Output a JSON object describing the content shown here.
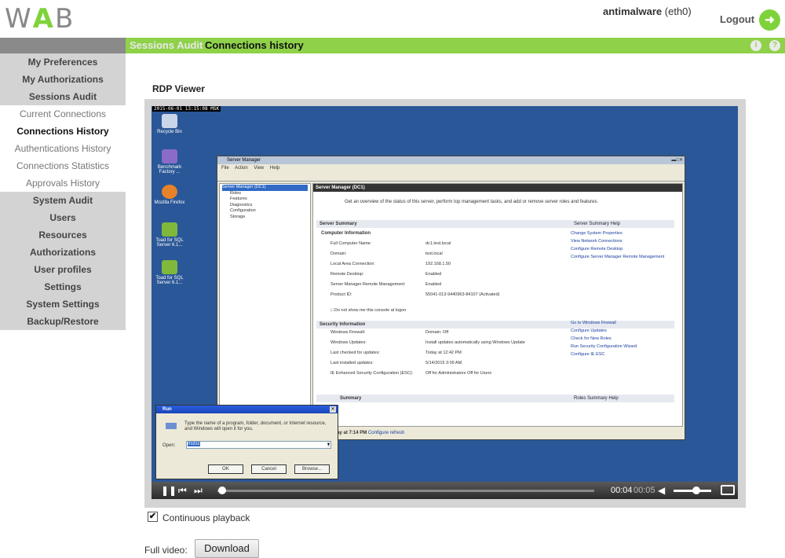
{
  "header": {
    "logo_left": "W",
    "logo_mid": "A",
    "logo_right": "B",
    "user_name": "antimalware",
    "user_iface": "(eth0)",
    "logout_label": "Logout"
  },
  "navbar": {
    "parent": "Sessions Audit",
    "current": "Connections history",
    "info_icon": "i",
    "help_icon": "?"
  },
  "sidebar": {
    "items": [
      {
        "label": "My Preferences",
        "type": "section"
      },
      {
        "label": "My Authorizations",
        "type": "section"
      },
      {
        "label": "Sessions Audit",
        "type": "section"
      },
      {
        "label": "Current Connections",
        "type": "sub"
      },
      {
        "label": "Connections History",
        "type": "sub-active"
      },
      {
        "label": "Authentications History",
        "type": "sub"
      },
      {
        "label": "Connections Statistics",
        "type": "sub"
      },
      {
        "label": "Approvals History",
        "type": "sub"
      },
      {
        "label": "System Audit",
        "type": "section"
      },
      {
        "label": "Users",
        "type": "section"
      },
      {
        "label": "Resources",
        "type": "section"
      },
      {
        "label": "Authorizations",
        "type": "section"
      },
      {
        "label": "User profiles",
        "type": "section"
      },
      {
        "label": "Settings",
        "type": "section"
      },
      {
        "label": "System Settings",
        "type": "section"
      },
      {
        "label": "Backup/Restore",
        "type": "section"
      }
    ]
  },
  "main": {
    "title": "RDP Viewer",
    "continuous_label": "Continuous playback",
    "continuous_checked": true,
    "full_video_label": "Full video:",
    "download_label": "Download"
  },
  "player": {
    "timestamp": "2015-06-01 13:15:08 MSK",
    "current_time": "00:04",
    "total_time": "00:05",
    "progress_fraction": 0.01,
    "volume_fraction": 0.6
  },
  "desktop": {
    "icons": [
      "Recycle Bin",
      "Benchmark Factory ...",
      "Mozilla Firefox",
      "Toad for SQL Server 6.1...",
      "Toad for SQL Server 6.1..."
    ]
  },
  "server_manager": {
    "title": "Server Manager",
    "menu": "File  Action  View  Help",
    "tree": [
      "Server Manager (DC1)",
      "Roles",
      "Features",
      "Diagnostics",
      "Configuration",
      "Storage"
    ],
    "header": "Server Manager (DC1)",
    "desc": "Get an overview of the status of this server, perform top management tasks, and add or remove server roles and features.",
    "summary_title": "Server Summary",
    "summary_help": "Server Summary Help",
    "computer_info": "Computer Information",
    "kv": [
      {
        "k": "Full Computer Name:",
        "v": "dc1.test.local"
      },
      {
        "k": "Domain:",
        "v": "test.local"
      },
      {
        "k": "Local Area Connection:",
        "v": "192.168.1.50"
      },
      {
        "k": "Remote Desktop:",
        "v": "Enabled"
      },
      {
        "k": "Server Manager Remote Management:",
        "v": "Enabled"
      },
      {
        "k": "Product ID:",
        "v": "55041-013-9440963-84107 (Activated)"
      }
    ],
    "links1": [
      "Change System Properties",
      "View Network Connections",
      "Configure Remote Desktop",
      "Configure Server Manager Remote Management"
    ],
    "dont_show": "Do not show me this console at logon",
    "security_title": "Security Information",
    "skv": [
      {
        "k": "Windows Firewall:",
        "v": "Domain: Off"
      },
      {
        "k": "Windows Updates:",
        "v": "Install updates automatically using Windows Update"
      },
      {
        "k": "Last checked for updates:",
        "v": "Today at 12:42 PM"
      },
      {
        "k": "Last installed updates:",
        "v": "5/14/2015 3:09 AM"
      },
      {
        "k": "IE Enhanced Security Configuration (ESC):",
        "v": "Off for Administrators Off for Users"
      }
    ],
    "links2": [
      "Go to Windows Firewall",
      "Configure Updates",
      "Check for New Roles",
      "Run Security Configuration Wizard",
      "Configure IE ESC"
    ],
    "roles_summary": "Summary",
    "roles_help": "Roles Summary Help",
    "status": "sh: Today at 7:14 PM",
    "refresh": "Configure refresh"
  },
  "run_dialog": {
    "title": "Run",
    "text": "Type the name of a program, folder, document, or Internet resource, and Windows will open it for you.",
    "open_label": "Open:",
    "value": "mstsc",
    "ok": "OK",
    "cancel": "Cancel",
    "browse": "Browse..."
  },
  "colors": {
    "accent": "#8fd24a",
    "desktop": "#2a5797",
    "sidebar_section": "#d3d3d3"
  }
}
